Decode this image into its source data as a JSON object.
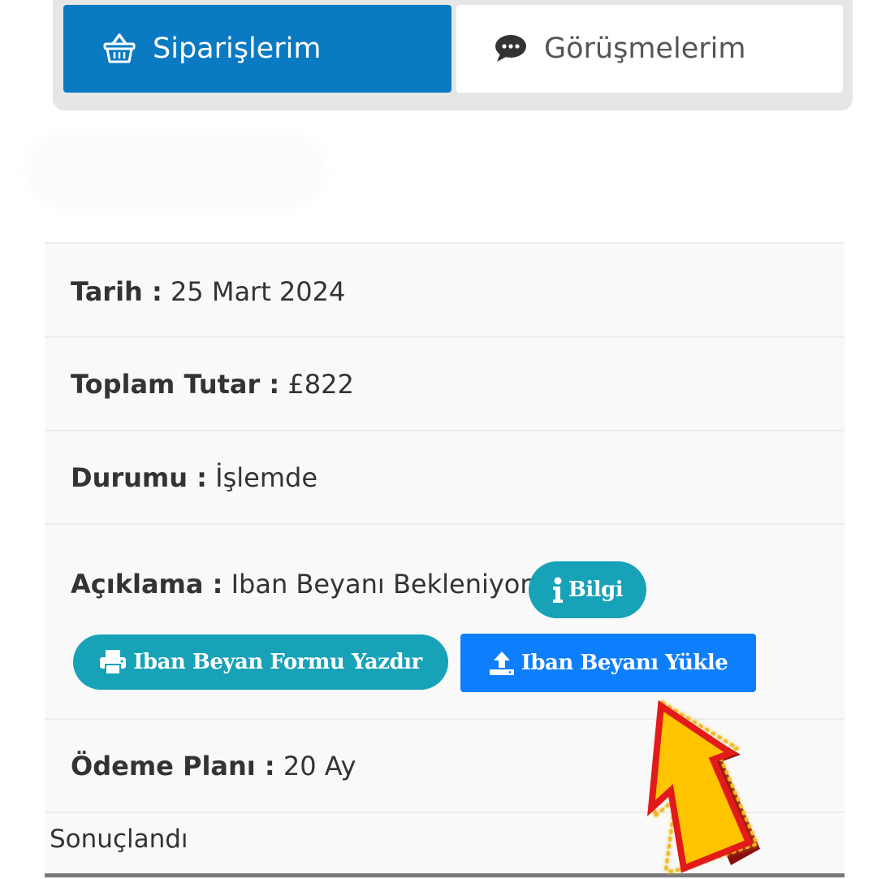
{
  "tabs": {
    "orders": {
      "label": "Siparişlerim",
      "icon": "basket-icon"
    },
    "conversations": {
      "label": "Görüşmelerim",
      "icon": "chat-bubble-icon"
    }
  },
  "order": {
    "date": {
      "label": "Tarih :",
      "value": "25 Mart 2024"
    },
    "total": {
      "label": "Toplam Tutar :",
      "value": "£822"
    },
    "status": {
      "label": "Durumu :",
      "value": "İşlemde"
    },
    "description": {
      "label": "Açıklama :",
      "value": "Iban Beyanı Bekleniyor"
    },
    "payment_plan": {
      "label": "Ödeme Planı :",
      "value": "20 Ay"
    },
    "footer_text": "Sonuçlandı"
  },
  "buttons": {
    "info": {
      "label": "Bilgi",
      "icon": "info-icon"
    },
    "print_form": {
      "label": "Iban Beyan Formu Yazdır",
      "icon": "printer-icon"
    },
    "upload": {
      "label": "Iban Beyanı Yükle",
      "icon": "upload-icon"
    }
  },
  "annotation": {
    "icon": "pointer-arrow-icon"
  },
  "colors": {
    "tab_active": "#0a7ac2",
    "teal": "#17a2b8",
    "upload_blue": "#0d7efc",
    "arrow_fill": "#ffc400",
    "arrow_outline": "#e31a1a"
  }
}
